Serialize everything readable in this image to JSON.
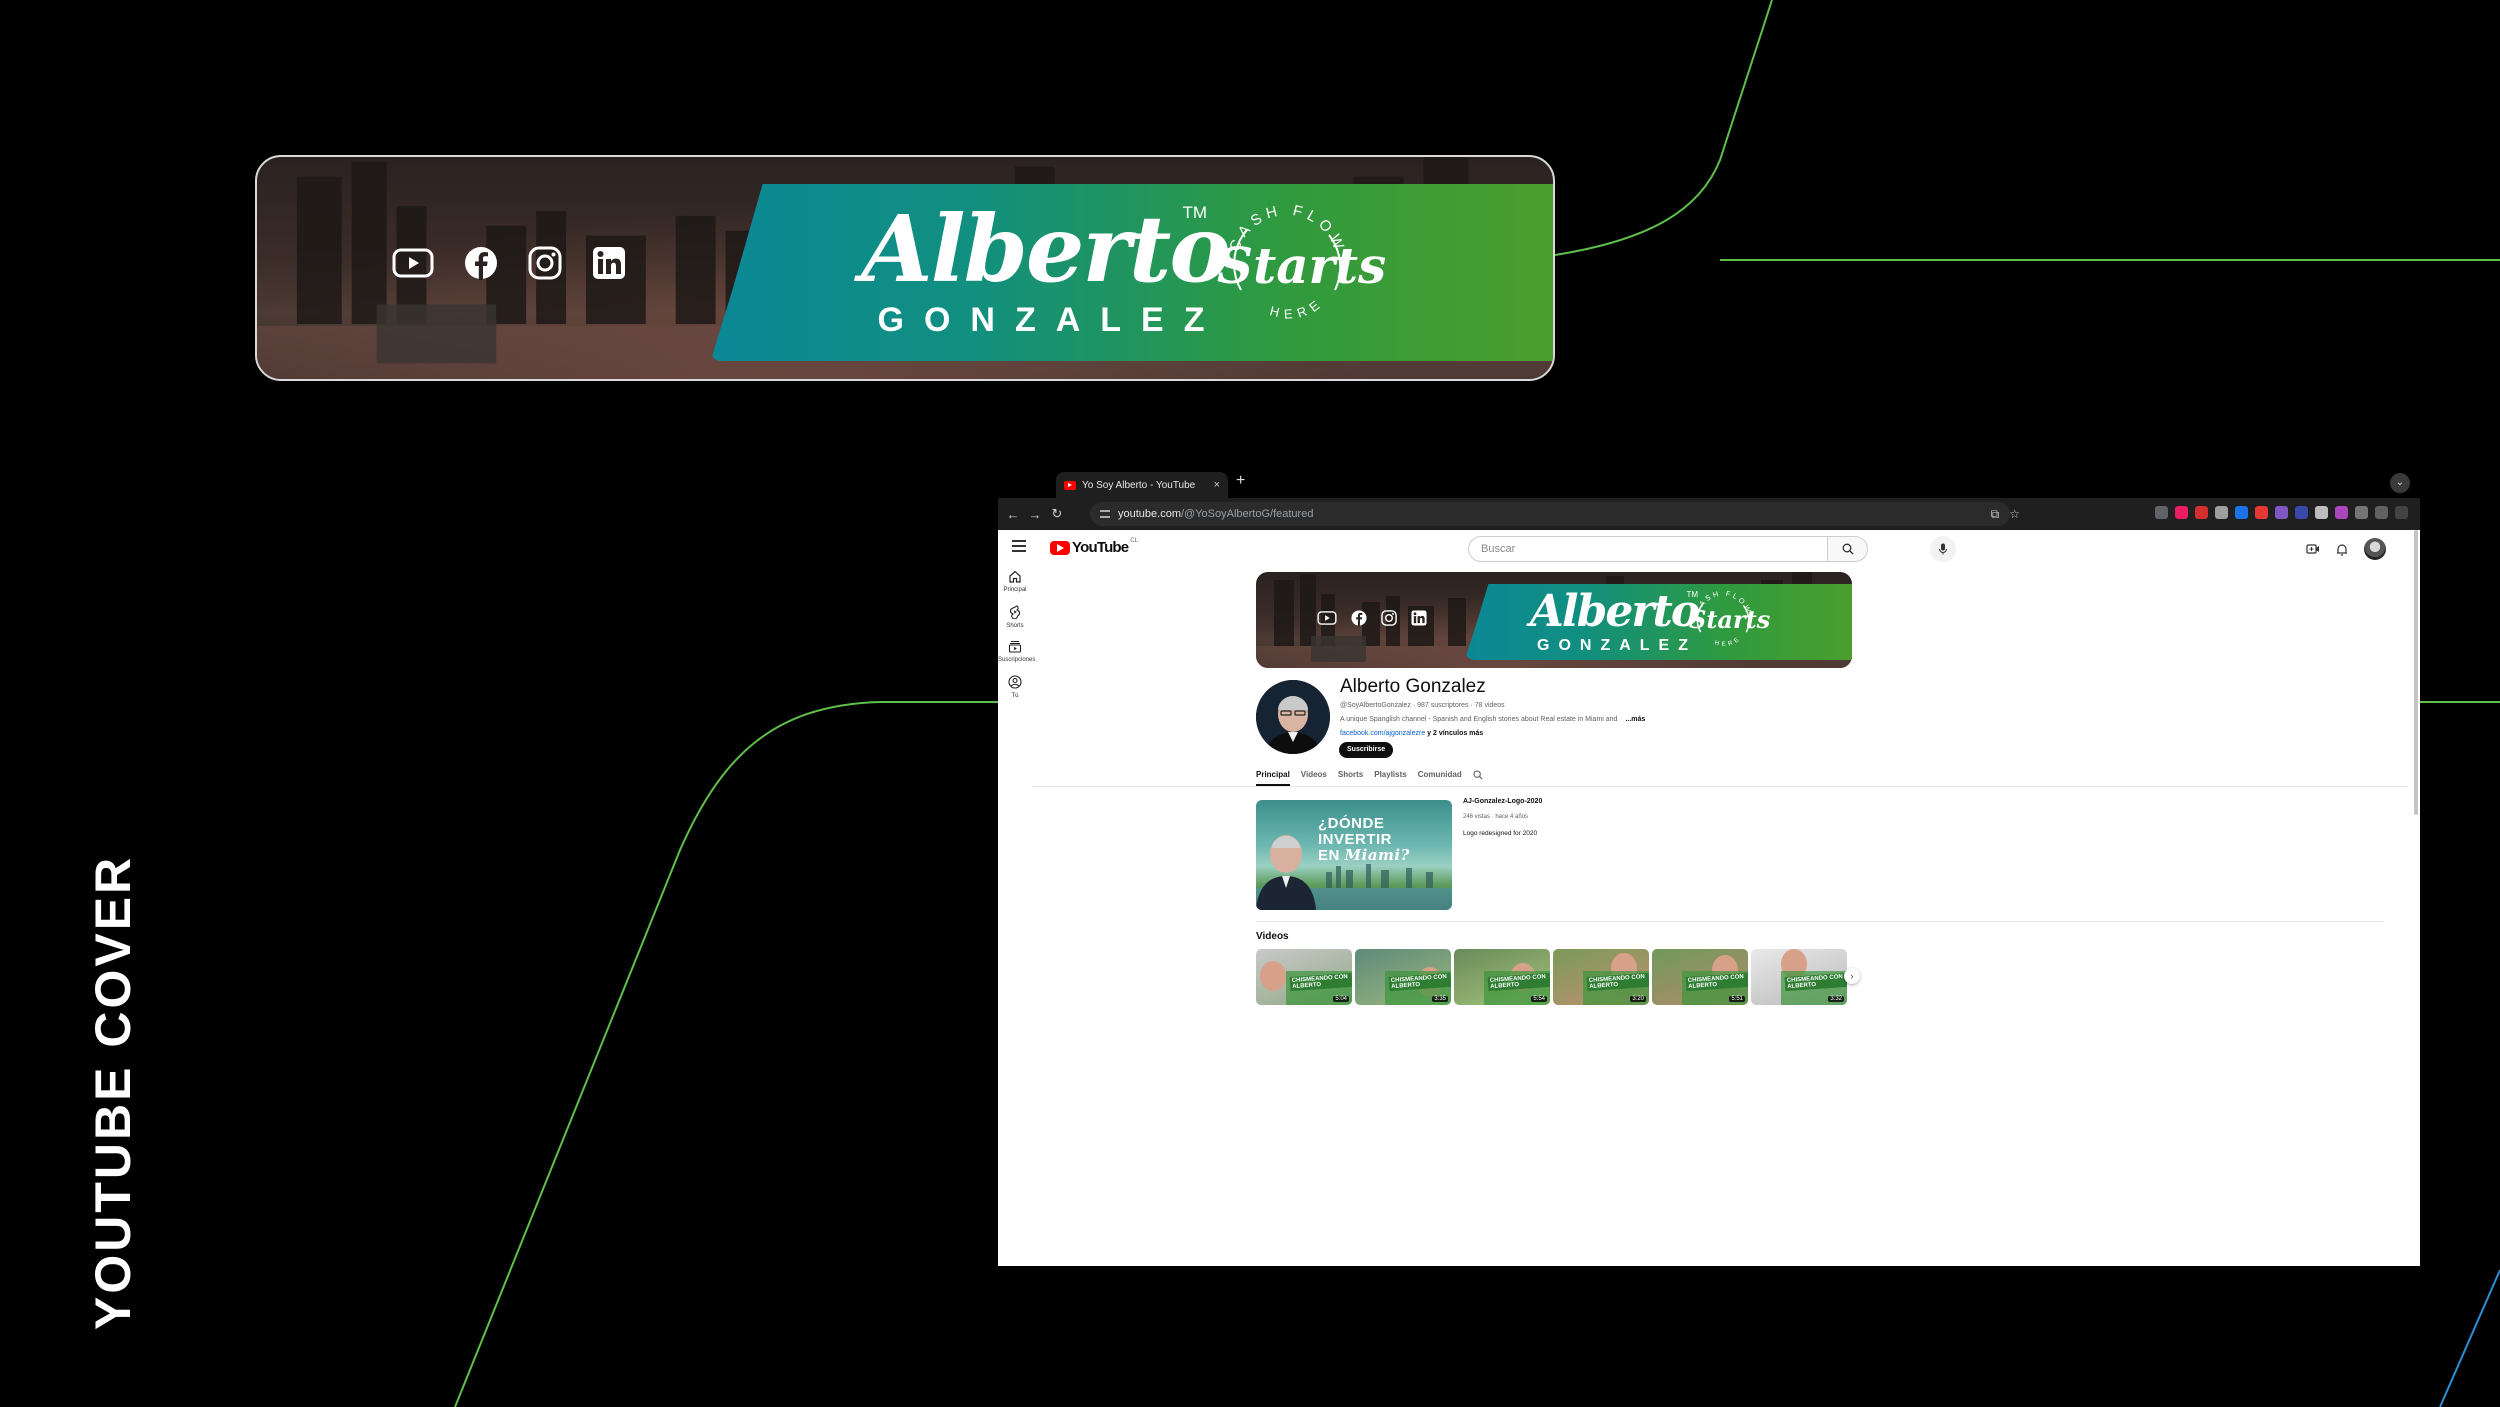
{
  "side_title": "YOUTUBE COVER",
  "banner": {
    "first_name": "Alberto",
    "last_name": "GONZALEZ",
    "trademark": "TM",
    "seal_top": "CASH FLOW",
    "seal_middle": "Starts",
    "seal_bottom": "HERE",
    "social_icons": [
      "youtube-icon",
      "facebook-icon",
      "instagram-icon",
      "linkedin-icon"
    ]
  },
  "browser": {
    "tab_title": "Yo Soy Alberto - YouTube",
    "tab_close": "×",
    "new_tab": "+",
    "url_host": "youtube.com",
    "url_path": "/@YoSoyAlbertoG/featured"
  },
  "youtube": {
    "logo_text": "YouTube",
    "logo_country": "CL",
    "search_placeholder": "Buscar",
    "guide": [
      {
        "label": "Principal",
        "icon": "home-icon"
      },
      {
        "label": "Shorts",
        "icon": "shorts-icon"
      },
      {
        "label": "Suscripciones",
        "icon": "subscriptions-icon"
      },
      {
        "label": "Tú",
        "icon": "you-icon"
      }
    ],
    "channel": {
      "name": "Alberto Gonzalez",
      "meta": "@SoyAlbertoGonzalez · 987 suscriptores · 78 videos",
      "description": "A unique Spanglish channel - Spanish and English stories about Real estate in Miami and",
      "more": "...más",
      "link": "facebook.com/ajgonzalezre",
      "more_links": " y 2 vínculos más",
      "subscribe_label": "Suscribirse"
    },
    "tabs": [
      "Principal",
      "Videos",
      "Shorts",
      "Playlists",
      "Comunidad"
    ],
    "featured": {
      "title": "AJ-Gonzalez-Logo-2020",
      "meta": "246 vistas · hace 4 años",
      "description": "Logo redesigned for 2020",
      "thumb_line1": "¿DÓNDE",
      "thumb_line2": "INVERTIR",
      "thumb_line3_a": "EN",
      "thumb_line3_b": "Miami?"
    },
    "videos_title": "Videos",
    "videos": [
      {
        "caption": "CHISMEANDO CON ALBERTO",
        "duration": "5:04"
      },
      {
        "caption": "CHISMEANDO CON ALBERTO",
        "duration": "3:35"
      },
      {
        "caption": "CHISMEANDO CON ALBERTO",
        "duration": "5:54"
      },
      {
        "caption": "CHISMEANDO CON ALBERTO",
        "duration": "3:20"
      },
      {
        "caption": "CHISMEANDO CON ALBERTO",
        "duration": "5:51"
      },
      {
        "caption": "CHISMEANDO CON ALBERTO",
        "duration": "3:32"
      }
    ],
    "next_label": "›"
  },
  "colors": {
    "accent_line": "#6fcf4f",
    "band_teal": "#0b8896",
    "band_green": "#4e9f2a",
    "yt_red": "#ff0000"
  }
}
